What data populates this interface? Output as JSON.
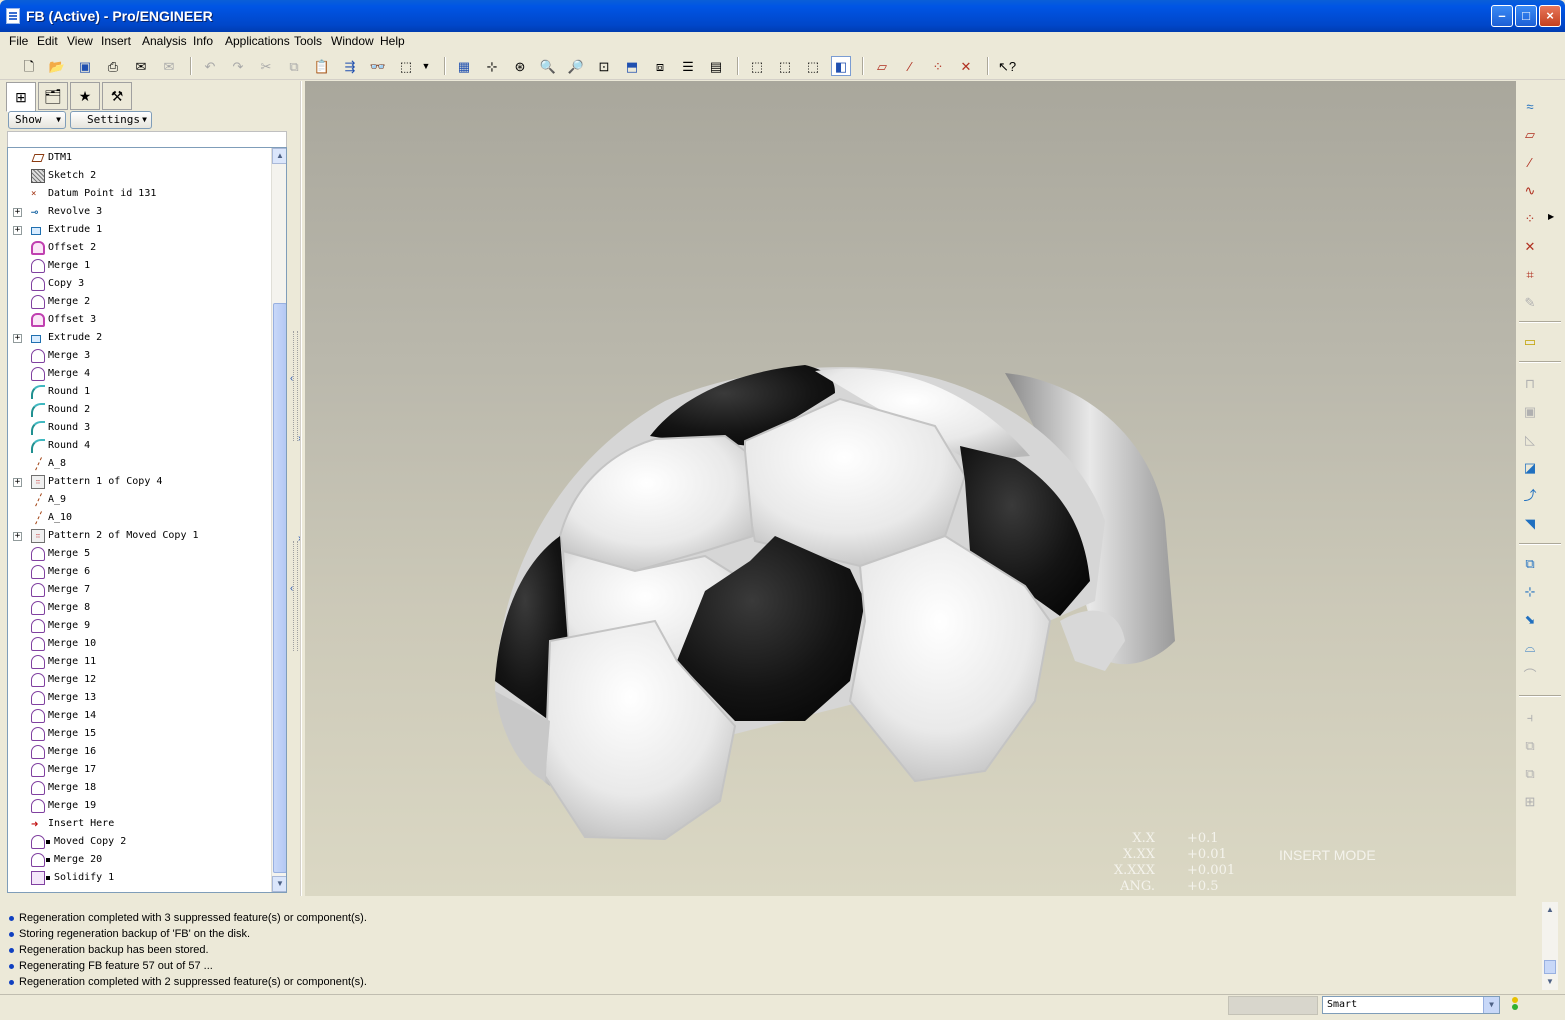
{
  "window": {
    "title": "FB (Active) - Pro/ENGINEER",
    "min_glyph": "–",
    "max_glyph": "□",
    "close_glyph": "×"
  },
  "menu": [
    "File",
    "Edit",
    "View",
    "Insert",
    "Analysis",
    "Info",
    "Applications",
    "Tools",
    "Window",
    "Help"
  ],
  "toolbar_icons": [
    "new-icon",
    "open-icon",
    "save-icon",
    "print-icon",
    "email-icon",
    "email-link-icon",
    "undo-icon",
    "redo-icon",
    "cut-icon",
    "copy-icon",
    "paste-icon",
    "paste-special-icon",
    "regenerate-icon",
    "find-icon",
    "select-box-icon",
    "dropdown-icon",
    "view-manager-icon",
    "orient-icon",
    "spin-center-icon",
    "zoom-in-icon",
    "zoom-out-icon",
    "refit-icon",
    "reorient-icon",
    "saved-views-icon",
    "layers-icon",
    "appearance-icon",
    "wireframe-icon",
    "hidden-line-icon",
    "no-hidden-icon",
    "shading-icon",
    "datum-plane-display-icon",
    "datum-axis-display-icon",
    "datum-point-display-icon",
    "coord-sys-display-icon",
    "context-help-icon"
  ],
  "navigator": {
    "tabs": [
      "model-tree-tab",
      "folder-browser-tab",
      "favorites-tab",
      "connections-tab"
    ],
    "show_label": "Show",
    "settings_label": "Settings"
  },
  "tree": {
    "items": [
      {
        "label": "DTM1",
        "icon": "datum-plane",
        "expandable": false
      },
      {
        "label": "Sketch 2",
        "icon": "sketch",
        "expandable": false
      },
      {
        "label": "Datum Point id 131",
        "icon": "datum-point",
        "expandable": false
      },
      {
        "label": "Revolve 3",
        "icon": "revolve",
        "expandable": true
      },
      {
        "label": "Extrude 1",
        "icon": "extrude",
        "expandable": true
      },
      {
        "label": "Offset 2",
        "icon": "offset",
        "expandable": false
      },
      {
        "label": "Merge 1",
        "icon": "merge",
        "expandable": false
      },
      {
        "label": "Copy 3",
        "icon": "copy",
        "expandable": false
      },
      {
        "label": "Merge 2",
        "icon": "merge",
        "expandable": false
      },
      {
        "label": "Offset 3",
        "icon": "offset",
        "expandable": false
      },
      {
        "label": "Extrude 2",
        "icon": "extrude",
        "expandable": true
      },
      {
        "label": "Merge 3",
        "icon": "merge",
        "expandable": false
      },
      {
        "label": "Merge 4",
        "icon": "merge",
        "expandable": false
      },
      {
        "label": "Round 1",
        "icon": "round",
        "expandable": false
      },
      {
        "label": "Round 2",
        "icon": "round",
        "expandable": false
      },
      {
        "label": "Round 3",
        "icon": "round",
        "expandable": false
      },
      {
        "label": "Round 4",
        "icon": "round",
        "expandable": false
      },
      {
        "label": "A_8",
        "icon": "datum-axis",
        "expandable": false
      },
      {
        "label": "Pattern 1 of Copy 4",
        "icon": "pattern",
        "expandable": true
      },
      {
        "label": "A_9",
        "icon": "datum-axis",
        "expandable": false
      },
      {
        "label": "A_10",
        "icon": "datum-axis",
        "expandable": false
      },
      {
        "label": "Pattern 2 of Moved Copy 1",
        "icon": "pattern",
        "expandable": true
      },
      {
        "label": "Merge 5",
        "icon": "merge",
        "expandable": false
      },
      {
        "label": "Merge 6",
        "icon": "merge",
        "expandable": false
      },
      {
        "label": "Merge 7",
        "icon": "merge",
        "expandable": false
      },
      {
        "label": "Merge 8",
        "icon": "merge",
        "expandable": false
      },
      {
        "label": "Merge 9",
        "icon": "merge",
        "expandable": false
      },
      {
        "label": "Merge 10",
        "icon": "merge",
        "expandable": false
      },
      {
        "label": "Merge 11",
        "icon": "merge",
        "expandable": false
      },
      {
        "label": "Merge 12",
        "icon": "merge",
        "expandable": false
      },
      {
        "label": "Merge 13",
        "icon": "merge",
        "expandable": false
      },
      {
        "label": "Merge 14",
        "icon": "merge",
        "expandable": false
      },
      {
        "label": "Merge 15",
        "icon": "merge",
        "expandable": false
      },
      {
        "label": "Merge 16",
        "icon": "merge",
        "expandable": false
      },
      {
        "label": "Merge 17",
        "icon": "merge",
        "expandable": false
      },
      {
        "label": "Merge 18",
        "icon": "merge",
        "expandable": false
      },
      {
        "label": "Merge 19",
        "icon": "merge",
        "expandable": false
      },
      {
        "label": "Insert Here",
        "icon": "insert-here",
        "expandable": false
      },
      {
        "label": "Moved Copy 2",
        "icon": "moved-copy",
        "expandable": false,
        "suppressed": true
      },
      {
        "label": "Merge 20",
        "icon": "merge",
        "expandable": false,
        "suppressed": true
      },
      {
        "label": "Solidify 1",
        "icon": "solidify",
        "expandable": false,
        "suppressed": true
      }
    ]
  },
  "viewport": {
    "tolerances": [
      {
        "key": "X.X",
        "value": "+0.1"
      },
      {
        "key": "X.XX",
        "value": "+0.01"
      },
      {
        "key": "X.XXX",
        "value": "+0.001"
      },
      {
        "key": "ANG.",
        "value": "+0.5"
      }
    ],
    "mode": "INSERT MODE"
  },
  "right_toolbar_icons": [
    "sketch-tool-icon",
    "datum-plane-tool-icon",
    "datum-axis-tool-icon",
    "datum-curve-tool-icon",
    "datum-point-tool-icon",
    "coord-sys-tool-icon",
    "analysis-feature-icon",
    "annotation-icon",
    "hole-tool-icon",
    "shell-tool-icon",
    "rib-tool-icon",
    "draft-tool-icon",
    "round-tool-icon",
    "chamfer-tool-icon",
    "extrude-tool-icon",
    "revolve-tool-icon",
    "variable-sweep-icon",
    "blend-tool-icon",
    "style-tool-icon",
    "mirror-tool-icon",
    "merge-tool-icon",
    "trim-tool-icon",
    "pattern-tool-icon"
  ],
  "messages": [
    "Regeneration completed with 3 suppressed feature(s) or component(s).",
    "Storing regeneration backup of 'FB' on the disk.",
    "Regeneration backup has been stored.",
    "Regenerating FB feature 57 out of 57 ...",
    "Regeneration completed with 2 suppressed feature(s) or component(s)."
  ],
  "status": {
    "filter": "Smart"
  },
  "colors": {
    "titlebar": "#0055e5",
    "viewport_top": "#a9a79c",
    "viewport_bottom": "#dbd8c4",
    "bullet": "#1040c0"
  }
}
